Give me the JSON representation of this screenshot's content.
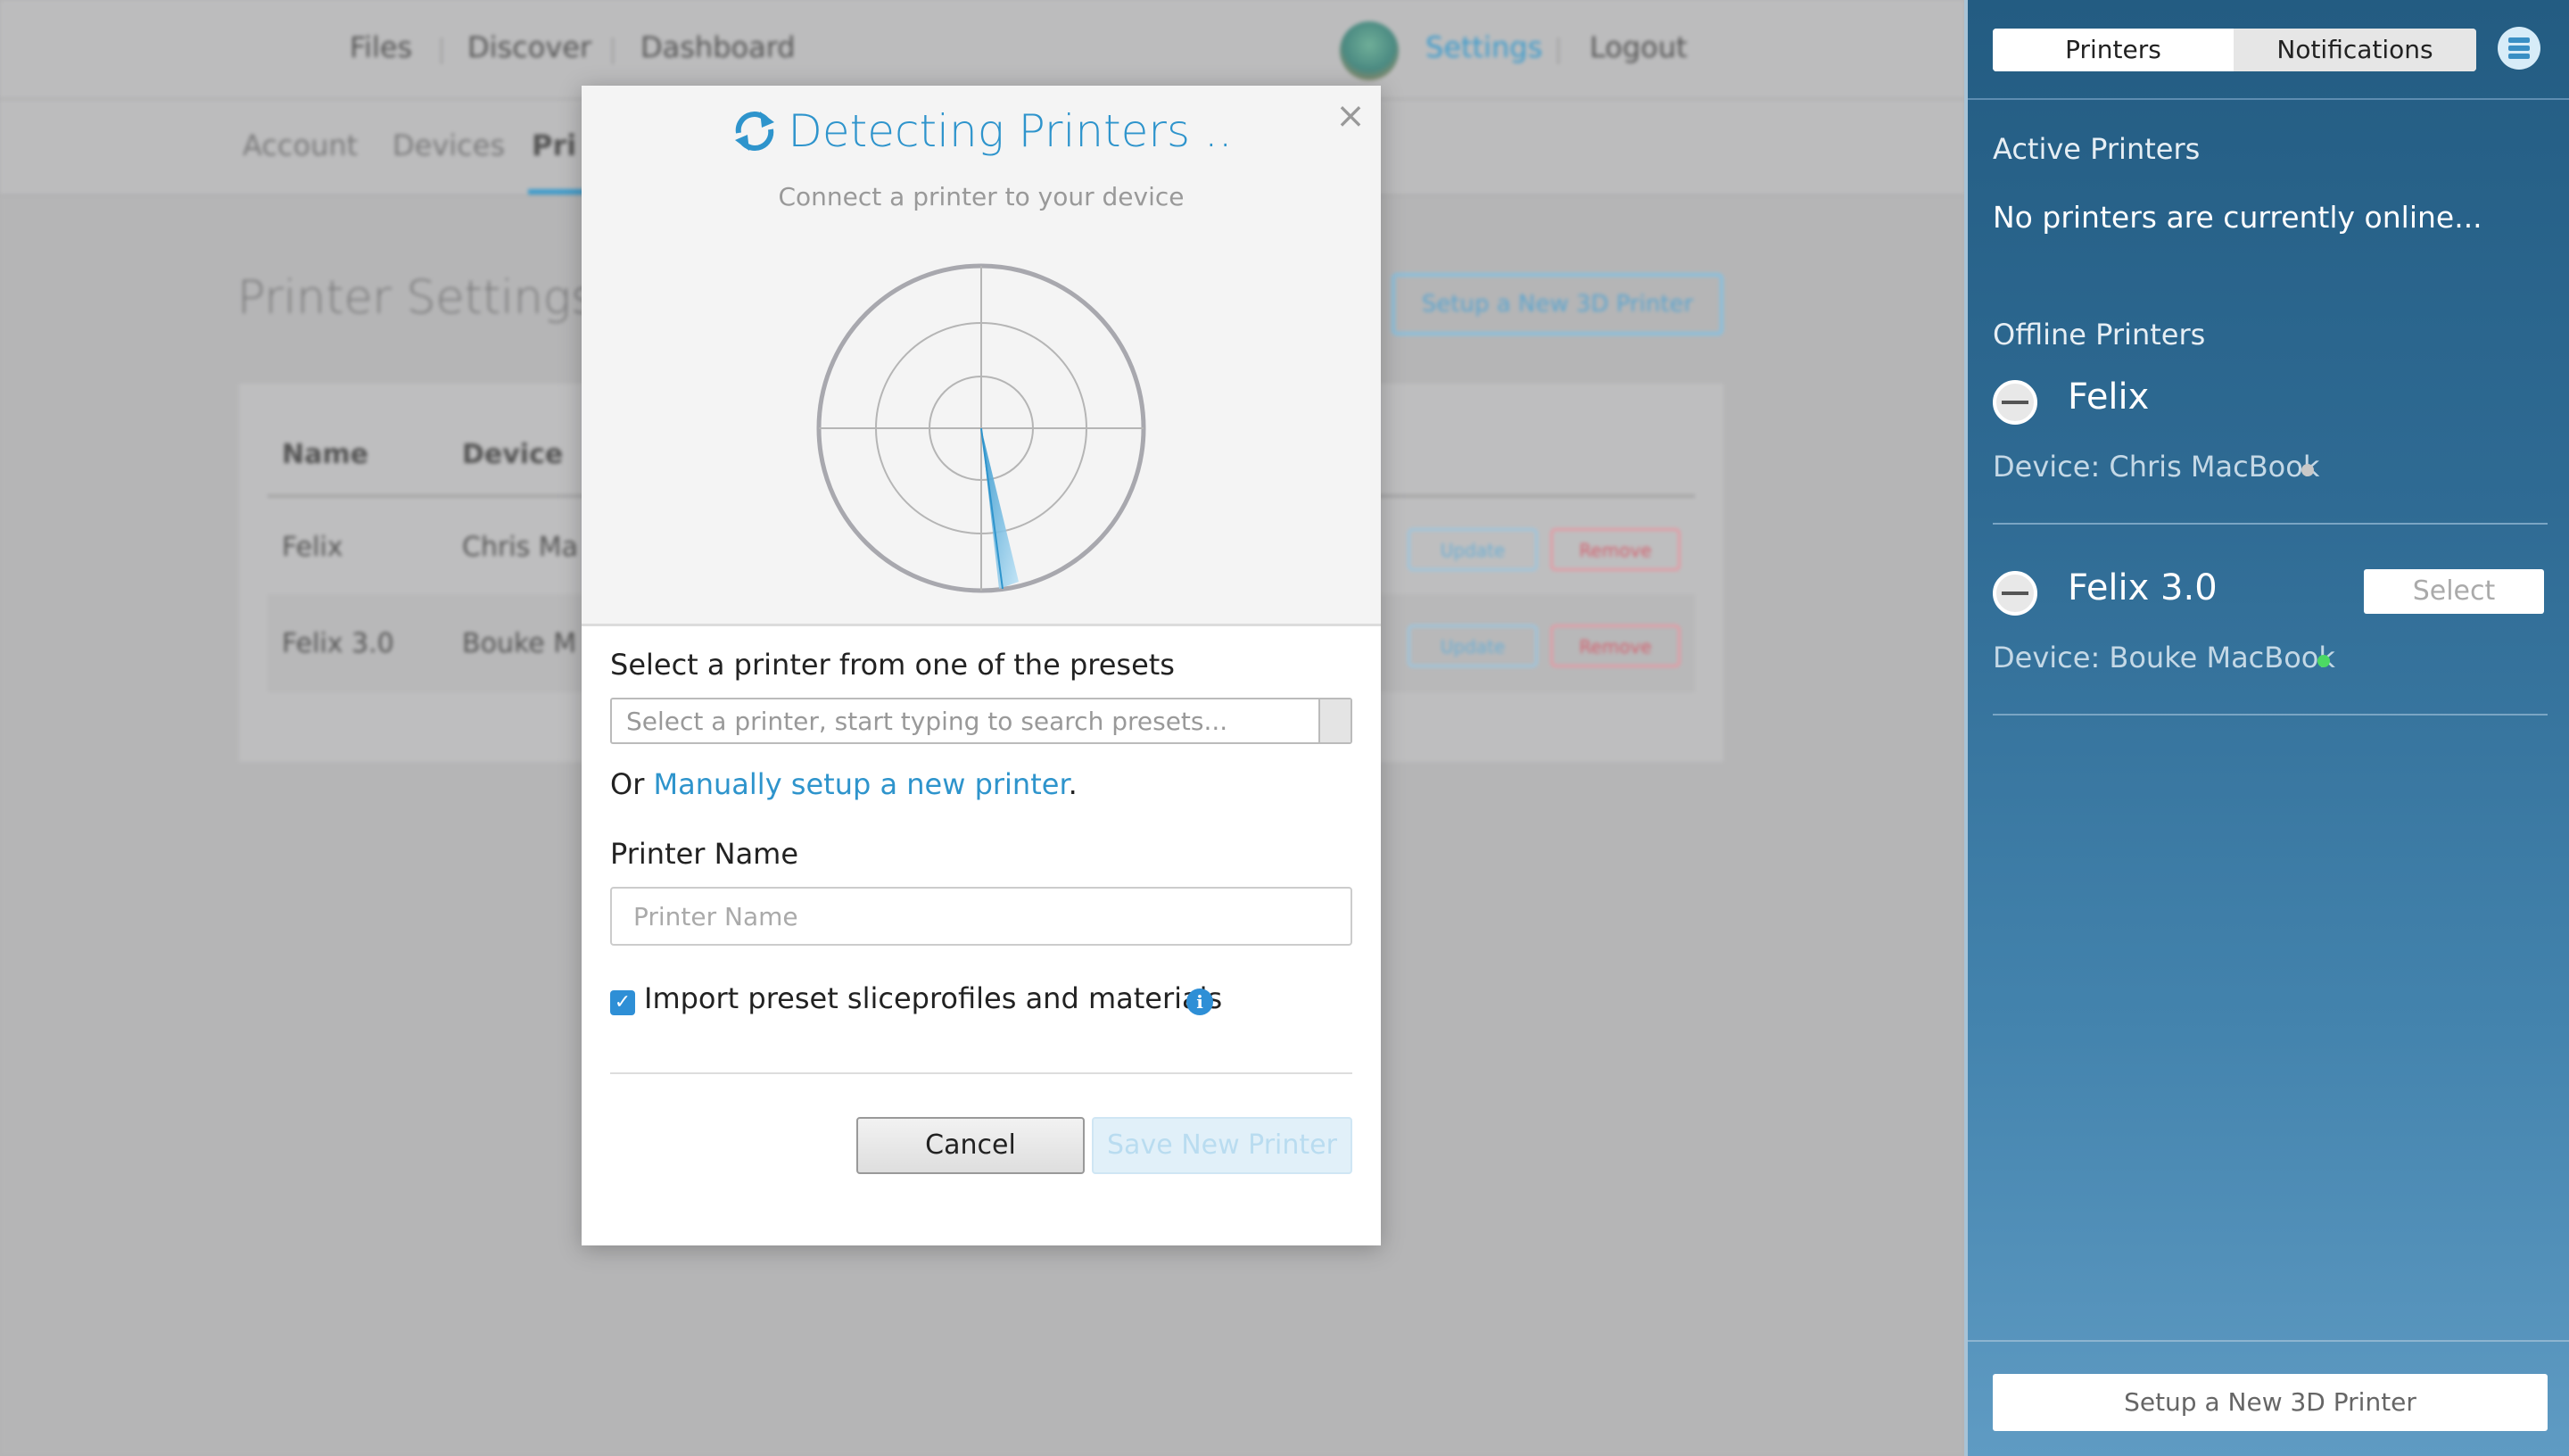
{
  "topnav": {
    "files": "Files",
    "discover": "Discover",
    "dashboard": "Dashboard",
    "settings": "Settings",
    "logout": "Logout"
  },
  "subnav": {
    "account": "Account",
    "devices": "Devices",
    "printers_partial": "Pri"
  },
  "page": {
    "title": "Printer Settings",
    "setup_button": "Setup a New 3D Printer",
    "table": {
      "headers": [
        "Name",
        "Device"
      ],
      "rows": [
        {
          "name": "Felix",
          "device": "Chris Ma",
          "update": "Update",
          "remove": "Remove"
        },
        {
          "name": "Felix 3.0",
          "device": "Bouke M",
          "update": "Update",
          "remove": "Remove"
        }
      ]
    }
  },
  "modal": {
    "title": "Detecting Printers ..",
    "subtitle": "Connect a printer to your device",
    "close": "×",
    "preset_label": "Select a printer from one of the presets",
    "preset_placeholder": "Select a printer, start typing to search presets...",
    "or_text": "Or ",
    "manual_link": "Manually setup a new printer",
    "period": ".",
    "name_label": "Printer Name",
    "name_placeholder": "Printer Name",
    "import_label": "Import preset sliceprofiles and materials",
    "import_checked": true,
    "cancel": "Cancel",
    "save": "Save New Printer"
  },
  "panel": {
    "tabs": [
      "Printers",
      "Notifications"
    ],
    "active_tab": "Printers",
    "active_heading": "Active Printers",
    "active_message": "No printers are currently online...",
    "offline_heading": "Offline Printers",
    "printers": [
      {
        "name": "Felix",
        "device": "Device: Chris MacBook",
        "status_color": "#c8c8c8"
      },
      {
        "name": "Felix 3.0",
        "device": "Device: Bouke MacBook",
        "status_color": "#4cd964",
        "action": "Select"
      }
    ],
    "footer_button": "Setup a New 3D Printer"
  },
  "colors": {
    "accent": "#2e94cc",
    "panel_top": "#235c82",
    "panel_bottom": "#5f9bc3"
  }
}
